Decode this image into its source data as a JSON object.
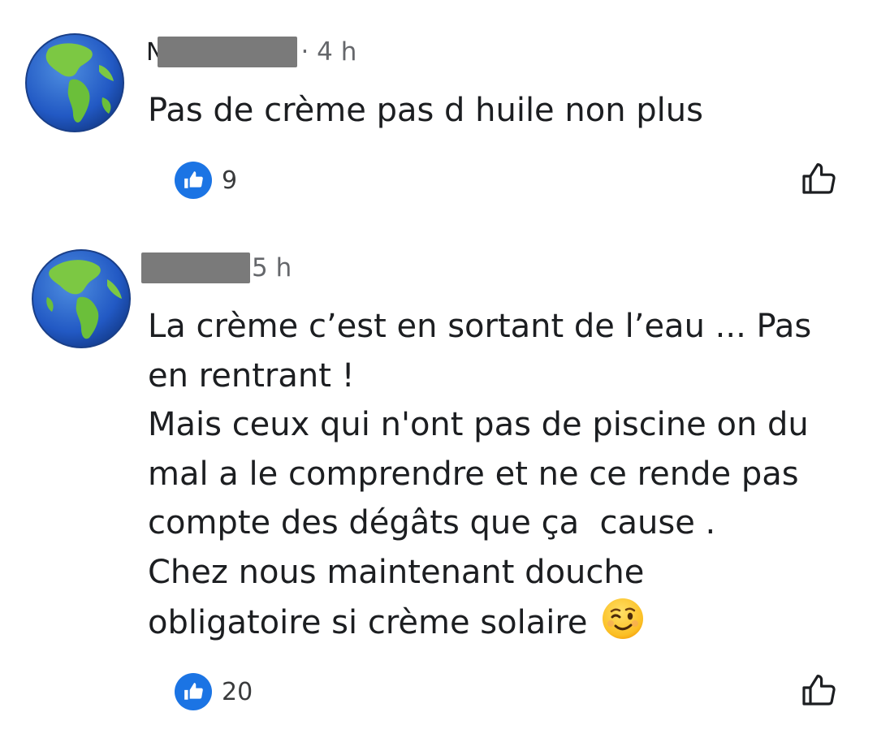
{
  "comments": [
    {
      "author_initial": "N",
      "author_redacted": true,
      "time": "· 4 h",
      "text_lines": [
        "Pas de crème pas d huile non plus"
      ],
      "like_count": "9",
      "avatar_icon": "globe-icon",
      "like_action_icon": "thumbs-up-outline-icon"
    },
    {
      "author_initial": "",
      "author_redacted": true,
      "time": "5 h",
      "text_lines": [
        "La crème c’est en sortant de l’eau ... Pas",
        "en rentrant !",
        "Mais ceux qui n'ont pas de piscine on du",
        "mal a le comprendre et ne ce rende pas",
        "compte des dégâts que ça  cause .",
        "Chez nous maintenant douche",
        "obligatoire si crème solaire"
      ],
      "emoji": "winking-face-emoji",
      "like_count": "20",
      "avatar_icon": "globe-icon",
      "like_action_icon": "thumbs-up-outline-icon"
    }
  ],
  "colors": {
    "like_blue": "#1b74e4",
    "secondary_text": "#65676b",
    "primary_text": "#1c1e21",
    "redaction": "#7a7a7a"
  }
}
